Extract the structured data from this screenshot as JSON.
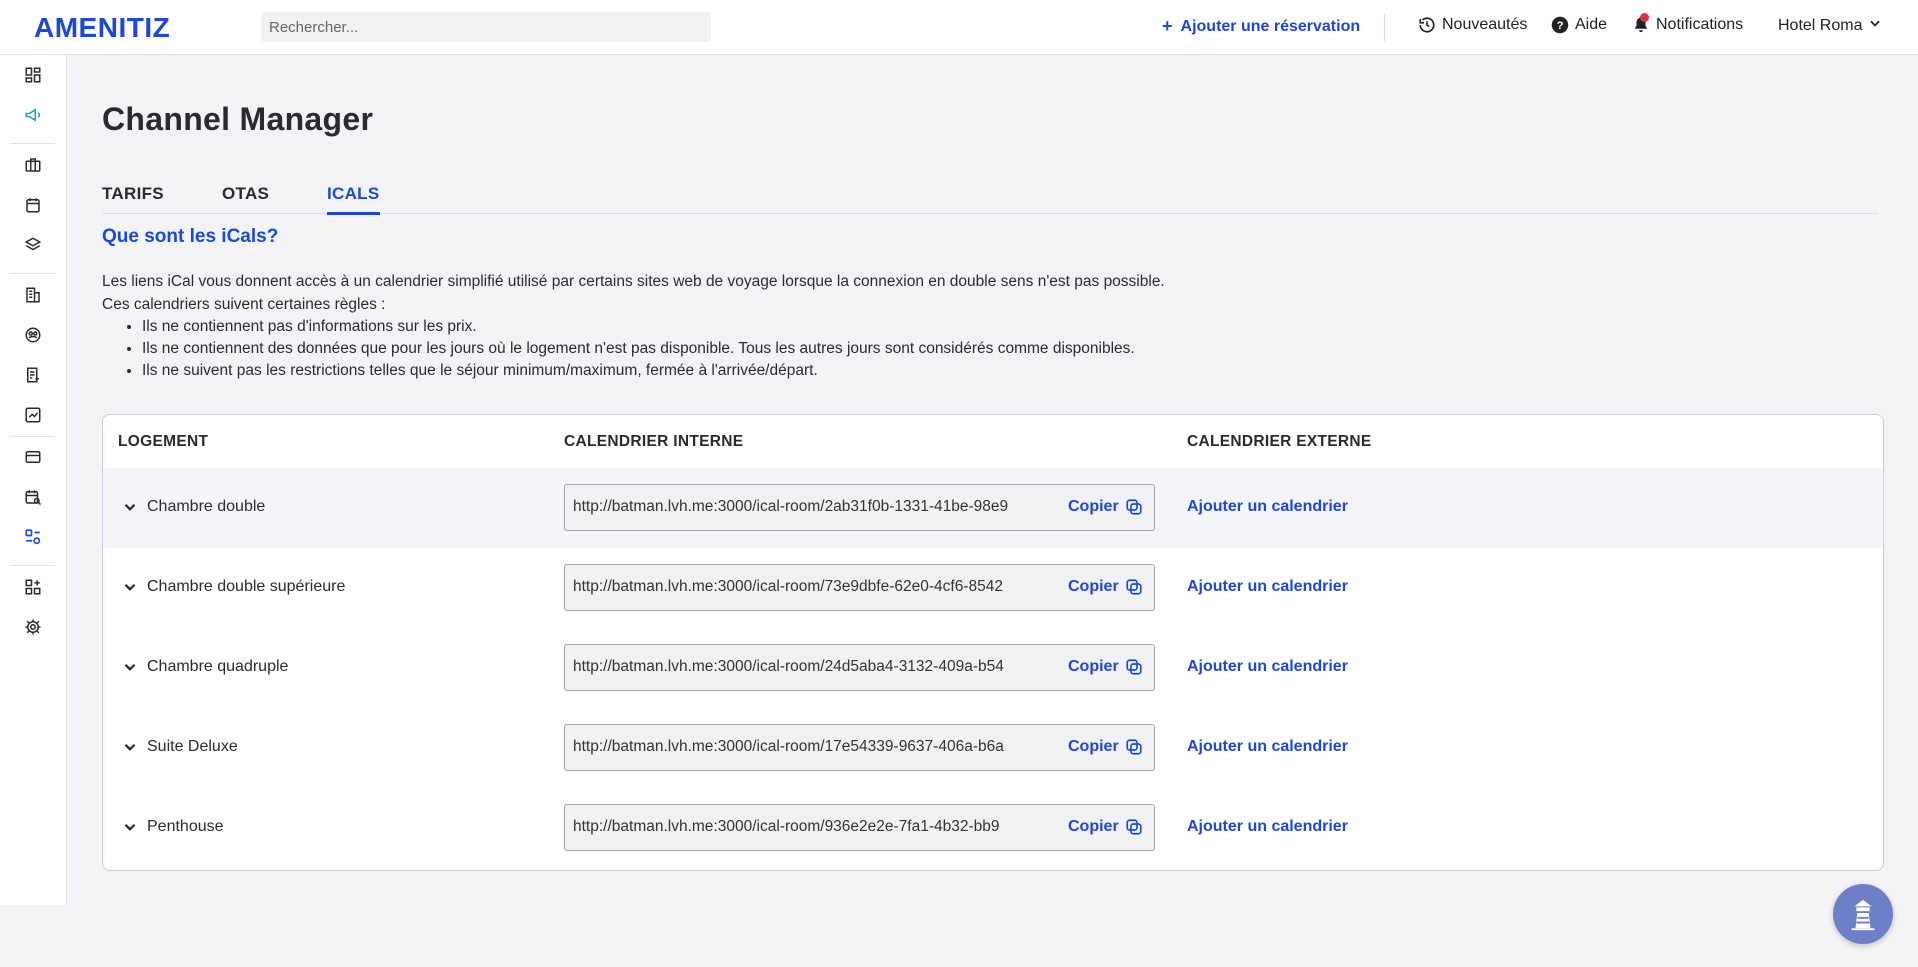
{
  "brand": {
    "logo_text": "AMENITIZ",
    "accent": "#1d47d8"
  },
  "topbar": {
    "search_placeholder": "Rechercher...",
    "add_reservation": "Ajouter une réservation",
    "whats_new": "Nouveautés",
    "help": "Aide",
    "notifications": "Notifications",
    "hotel": "Hotel Roma"
  },
  "sidebar": {
    "icons": [
      "dashboard-icon",
      "megaphone-icon",
      "briefcase-icon",
      "calendar-icon",
      "layers-icon",
      "building-icon",
      "guests-icon",
      "invoice-icon",
      "analytics-icon",
      "card-icon",
      "calendar-search-icon",
      "channel-manager-icon",
      "apps-icon",
      "settings-icon"
    ],
    "active": "channel-manager-icon"
  },
  "page": {
    "title": "Channel Manager",
    "tabs": [
      {
        "label": "TARIFS",
        "active": false
      },
      {
        "label": "OTAS",
        "active": false
      },
      {
        "label": "ICALS",
        "active": true
      }
    ],
    "section_title": "Que sont les iCals?",
    "desc_line1": "Les liens iCal vous donnent accès à un calendrier simplifié utilisé par certains sites web de voyage lorsque la connexion en double sens n'est pas possible.",
    "desc_line2": "Ces calendriers suivent certaines règles :",
    "rules": [
      "Ils ne contiennent pas d'informations sur les prix.",
      "Ils ne contiennent des données que pour les jours où le logement n'est pas disponible. Tous les autres jours sont considérés comme disponibles.",
      "Ils ne suivent pas les restrictions telles que le séjour minimum/maximum, fermée à l'arrivée/départ."
    ]
  },
  "table": {
    "headers": {
      "room": "LOGEMENT",
      "internal": "CALENDRIER INTERNE",
      "external": "CALENDRIER EXTERNE"
    },
    "copy_label": "Copier",
    "add_calendar_label": "Ajouter un calendrier",
    "rows": [
      {
        "room": "Chambre double",
        "url": "http://batman.lvh.me:3000/ical-room/2ab31f0b-1331-41be-98e9"
      },
      {
        "room": "Chambre double supérieure",
        "url": "http://batman.lvh.me:3000/ical-room/73e9dbfe-62e0-4cf6-8542"
      },
      {
        "room": "Chambre quadruple",
        "url": "http://batman.lvh.me:3000/ical-room/24d5aba4-3132-409a-b54"
      },
      {
        "room": "Suite Deluxe",
        "url": "http://batman.lvh.me:3000/ical-room/17e54339-9637-406a-b6a"
      },
      {
        "room": "Penthouse",
        "url": "http://batman.lvh.me:3000/ical-room/936e2e2e-7fa1-4b32-bb9"
      }
    ]
  }
}
